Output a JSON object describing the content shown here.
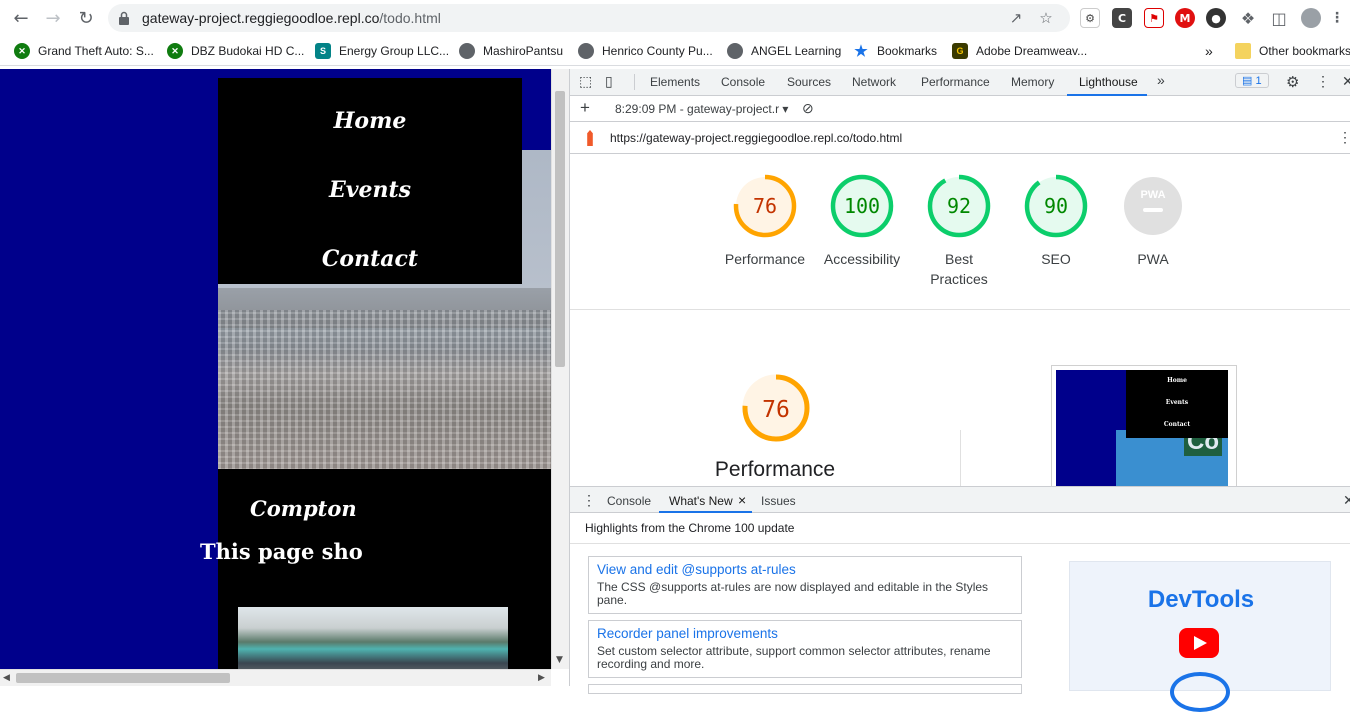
{
  "browser": {
    "url_host": "gateway-project.reggiegoodloe.repl.co",
    "url_path": "/todo.html",
    "bookmarks": [
      {
        "label": "Grand Theft Auto: S...",
        "icon": "xbox-icon",
        "color": "#107c10"
      },
      {
        "label": "DBZ Budokai HD C...",
        "icon": "xbox-icon",
        "color": "#107c10"
      },
      {
        "label": "Energy Group LLC...",
        "icon": "sharepoint-icon",
        "color": "#038387"
      },
      {
        "label": "MashiroPantsu",
        "icon": "globe-icon",
        "color": "#5f6368"
      },
      {
        "label": "Henrico County Pu...",
        "icon": "globe-icon",
        "color": "#5f6368"
      },
      {
        "label": "ANGEL Learning",
        "icon": "globe-icon",
        "color": "#5f6368"
      },
      {
        "label": "Bookmarks",
        "icon": "star-icon",
        "color": "#1a73e8"
      },
      {
        "label": "Adobe Dreamweav...",
        "icon": "dreamweaver-icon",
        "color": "#c4a000"
      }
    ],
    "overflow": "»",
    "other_bookmarks": "Other bookmarks"
  },
  "site": {
    "nav": [
      "Home",
      "Events",
      "Contact"
    ],
    "heading": "Compton",
    "subheading": "This page sho"
  },
  "devtools": {
    "tabs": [
      "Elements",
      "Console",
      "Sources",
      "Network",
      "Performance",
      "Memory",
      "Lighthouse"
    ],
    "active_tab": "Lighthouse",
    "more": "»",
    "issues_count": "1",
    "report_time": "8:29:09 PM - gateway-project.r",
    "report_url": "https://gateway-project.reggiegoodloe.repl.co/todo.html",
    "scores": [
      {
        "label": "Performance",
        "value": "76",
        "fraction": 0.76,
        "color": "#ffa400",
        "text_color": "#c33300",
        "bg": "#fff4e5"
      },
      {
        "label": "Accessibility",
        "value": "100",
        "fraction": 1.0,
        "color": "#0cce6b",
        "text_color": "#008800",
        "bg": "#e5faef"
      },
      {
        "label": "Best Practices",
        "value": "92",
        "fraction": 0.92,
        "color": "#0cce6b",
        "text_color": "#008800",
        "bg": "#e5faef"
      },
      {
        "label": "SEO",
        "value": "90",
        "fraction": 0.9,
        "color": "#0cce6b",
        "text_color": "#008800",
        "bg": "#e5faef"
      },
      {
        "label": "PWA",
        "value": "PWA",
        "fraction": 0,
        "color": "#cccccc",
        "text_color": "#ffffff",
        "bg": "#e0e0e0"
      }
    ],
    "big_score": {
      "label": "Performance",
      "value": "76",
      "fraction": 0.76
    },
    "thumb_nav": [
      "Home",
      "Events",
      "Contact"
    ],
    "thumb_sign": "Co",
    "drawer": {
      "tabs": [
        "Console",
        "What's New",
        "Issues"
      ],
      "active_tab": "What's New",
      "close": "×",
      "highlight": "Highlights from the Chrome 100 update",
      "cards": [
        {
          "title": "View and edit @supports at-rules",
          "desc": "The CSS @supports at-rules are now displayed and editable in the Styles pane."
        },
        {
          "title": "Recorder panel improvements",
          "desc": "Set custom selector attribute, support common selector attributes, rename recording and more."
        }
      ],
      "promo": "DevTools"
    }
  }
}
